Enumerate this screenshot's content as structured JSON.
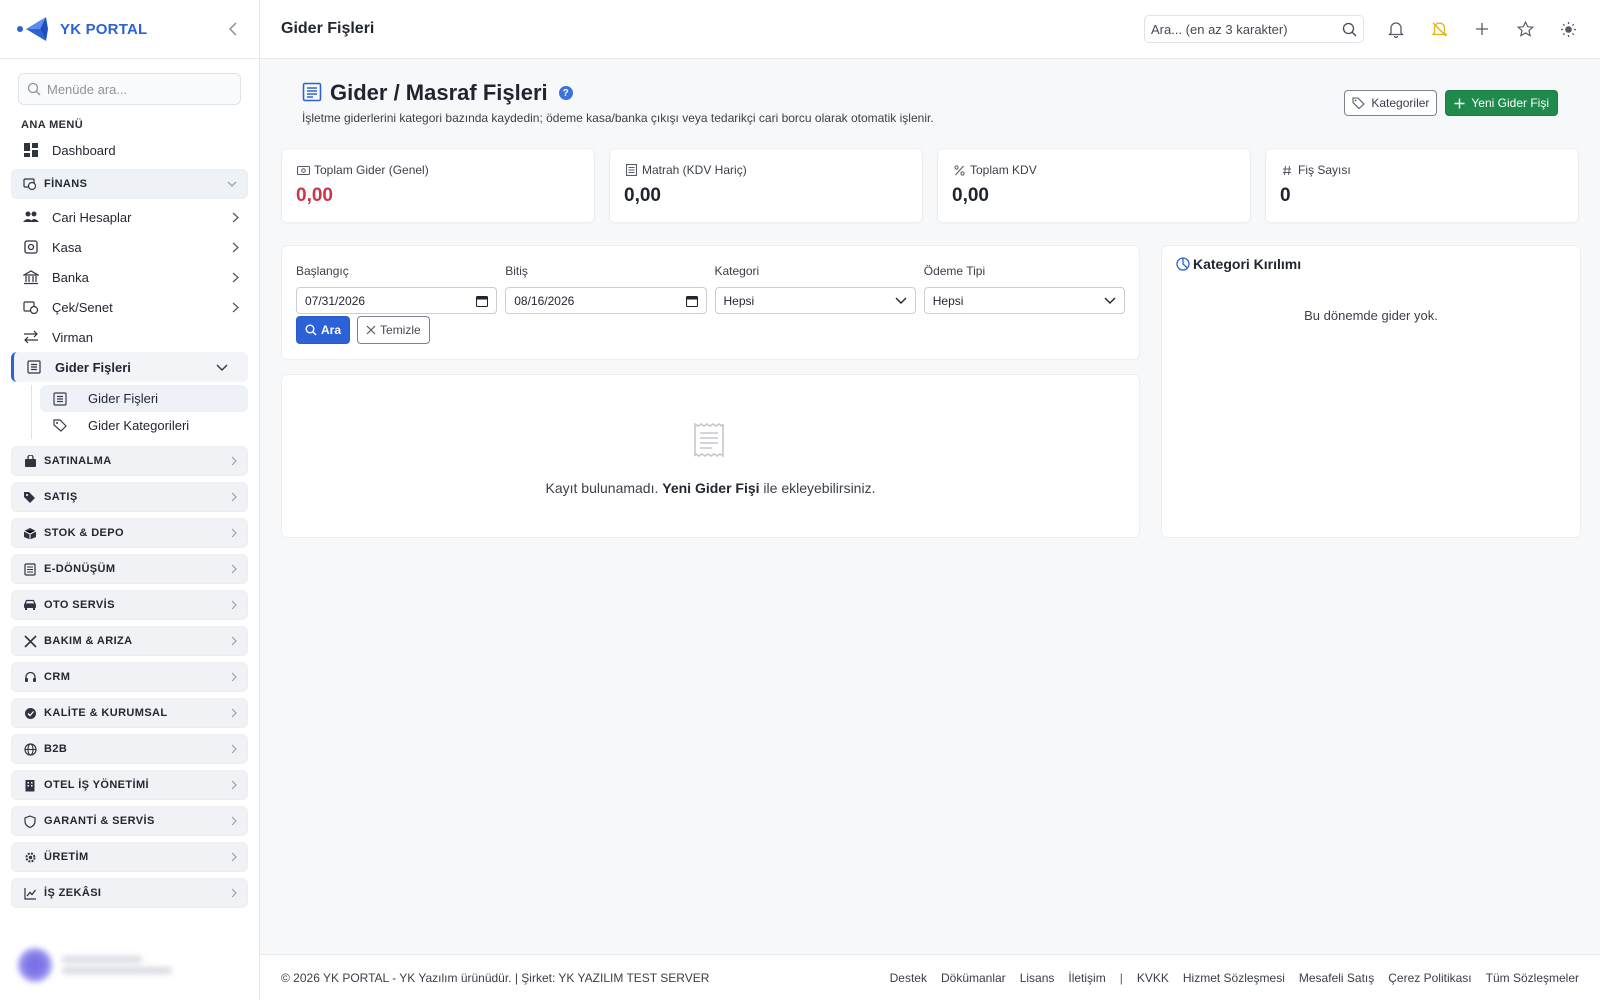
{
  "brand": {
    "name": "YK PORTAL",
    "color": "#2d62d6"
  },
  "sidebar": {
    "search_placeholder": "Menüde ara...",
    "section_label": "ANA MENÜ",
    "dashboard": "Dashboard",
    "finans_group": "FİNANS",
    "finans_items": [
      {
        "label": "Cari Hesaplar"
      },
      {
        "label": "Kasa"
      },
      {
        "label": "Banka"
      },
      {
        "label": "Çek/Senet"
      },
      {
        "label": "Virman"
      }
    ],
    "gider_parent": "Gider Fişleri",
    "gider_sub": [
      {
        "label": "Gider Fişleri"
      },
      {
        "label": "Gider Kategorileri"
      }
    ],
    "groups": [
      {
        "label": "SATINALMA"
      },
      {
        "label": "SATIŞ"
      },
      {
        "label": "STOK & DEPO"
      },
      {
        "label": "E-DÖNÜŞÜM"
      },
      {
        "label": "OTO SERVİS"
      },
      {
        "label": "BAKIM & ARIZA"
      },
      {
        "label": "CRM"
      },
      {
        "label": "KALİTE & KURUMSAL"
      },
      {
        "label": "B2B"
      },
      {
        "label": "OTEL İŞ YÖNETİMİ"
      },
      {
        "label": "GARANTİ & SERVİS"
      },
      {
        "label": "ÜRETİM"
      },
      {
        "label": "İŞ ZEKÂSI"
      }
    ]
  },
  "topbar": {
    "title": "Gider Fişleri",
    "search_placeholder": "Ara... (en az 3 karakter)"
  },
  "page": {
    "title": "Gider / Masraf Fişleri",
    "description": "İşletme giderlerini kategori bazında kaydedin; ödeme kasa/banka çıkışı veya tedarikçi cari borcu olarak otomatik işlenir.",
    "btn_categories": "Kategoriler",
    "btn_new": "Yeni Gider Fişi"
  },
  "stats": [
    {
      "label": "Toplam Gider (Genel)",
      "value": "0,00"
    },
    {
      "label": "Matrah (KDV Hariç)",
      "value": "0,00"
    },
    {
      "label": "Toplam KDV",
      "value": "0,00"
    },
    {
      "label": "Fiş Sayısı",
      "value": "0"
    }
  ],
  "filters": {
    "start_label": "Başlangıç",
    "start_value": "07/31/2026",
    "end_label": "Bitiş",
    "end_value": "08/16/2026",
    "category_label": "Kategori",
    "category_value": "Hepsi",
    "payment_label": "Ödeme Tipi",
    "payment_value": "Hepsi",
    "search_btn": "Ara",
    "clear_btn": "Temizle"
  },
  "empty": {
    "text_before": "Kayıt bulunamadı.",
    "text_bold": "Yeni Gider Fişi",
    "text_after": "ile ekleyebilirsiniz."
  },
  "category_panel": {
    "title": "Kategori Kırılımı",
    "empty": "Bu dönemde gider yok."
  },
  "footer": {
    "copyright": "© 2026 YK PORTAL - YK Yazılım ürünüdür. | Şirket: YK YAZILIM TEST SERVER",
    "links": [
      "Destek",
      "Dökümanlar",
      "Lisans",
      "İletişim"
    ],
    "separator": "|",
    "links2": [
      "KVKK",
      "Hizmet Sözleşmesi",
      "Mesafeli Satış",
      "Çerez Politikası",
      "Tüm Sözleşmeler"
    ]
  },
  "colors": {
    "accent": "#2d62d6",
    "green": "#1f8a4c",
    "red": "#d0344a"
  }
}
